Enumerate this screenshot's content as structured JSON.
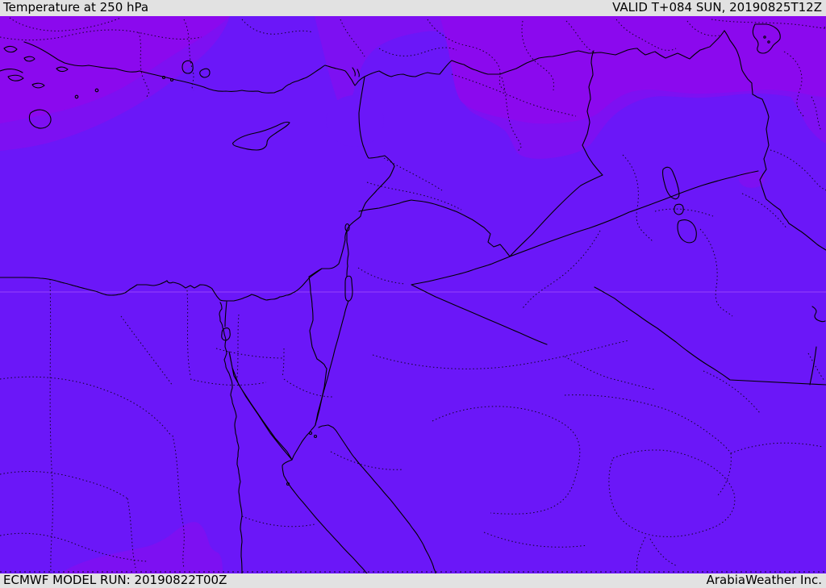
{
  "header": {
    "title": "Temperature at 250 hPa",
    "valid": "VALID T+084 SUN, 20190825T12Z"
  },
  "footer": {
    "model_run": "ECMWF MODEL RUN: 20190822T00Z",
    "brand": "ArabiaWeather Inc."
  },
  "map": {
    "description": "Filled 250 hPa temperature field over the Eastern Mediterranean and Middle East",
    "colors": {
      "bar_bg": "#e2e2e2",
      "bar_text": "#000000",
      "temp_cool_base": "#6b17f8",
      "temp_mid_band": "#7d10f2",
      "temp_warm_band": "#8b09ee",
      "line": "#000000"
    },
    "regions": [
      {
        "name": "warm band (north: Turkey, N Syria, N Iraq, NW Iran)",
        "color": "#8b09ee"
      },
      {
        "name": "transition band along contour edges and SW hill patch",
        "color": "#7d10f2"
      },
      {
        "name": "cool field (Mediterranean, Egypt, Levant, Arabia)",
        "color": "#6b17f8"
      }
    ],
    "features": [
      "Aegean islands",
      "Turkey south coast",
      "Cyprus",
      "Levant coast",
      "Nile river and delta",
      "Suez Canal and Bitter Lakes",
      "Sinai peninsula",
      "Gulf of Suez",
      "Gulf of Aqaba",
      "Red Sea",
      "Sea of Galilee",
      "Dead Sea",
      "Lake Urmia",
      "Iraqi lakes",
      "solid country borders",
      "dotted admin boundaries",
      "faint 30N gridline"
    ]
  }
}
